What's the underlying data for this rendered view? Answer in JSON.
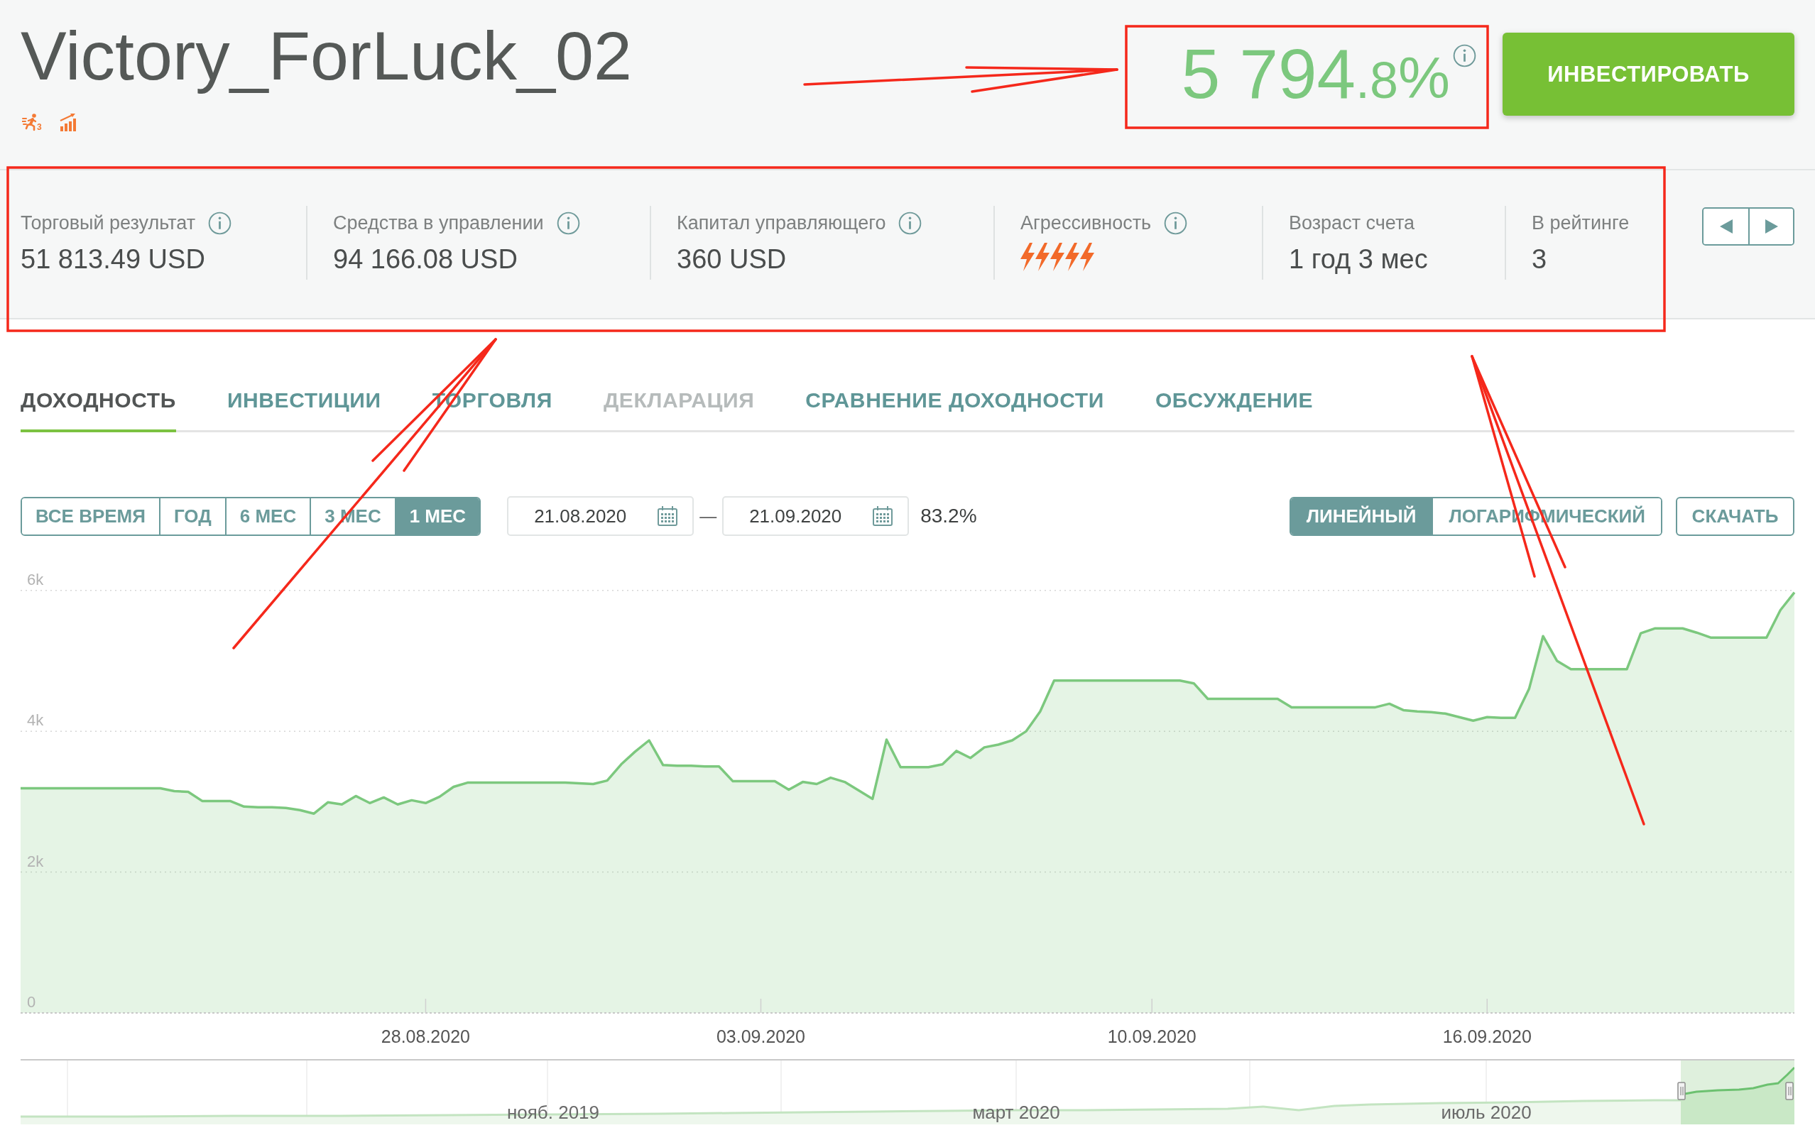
{
  "header": {
    "title": "Victory_ForLuck_02",
    "badges": [
      {
        "kind": "runner",
        "count": "3"
      },
      {
        "kind": "growth"
      }
    ],
    "return": {
      "integer": "5 794",
      "fraction": ".8",
      "unit": "%"
    },
    "invest_button": "ИНВЕСТИРОВАТЬ"
  },
  "stats": [
    {
      "kind": "value",
      "label": "Торговый результат",
      "info": true,
      "value": "51 813.49 USD"
    },
    {
      "kind": "value",
      "label": "Средства в управлении",
      "info": true,
      "value": "94 166.08 USD"
    },
    {
      "kind": "value",
      "label": "Капитал управляющего",
      "info": true,
      "value": "360 USD"
    },
    {
      "kind": "rating",
      "label": "Агрессивность",
      "info": true,
      "stars": 5
    },
    {
      "kind": "value",
      "label": "Возраст счета",
      "info": false,
      "value": "1 год 3 мес"
    },
    {
      "kind": "value",
      "label": "В рейтинге",
      "info": false,
      "value": "3"
    }
  ],
  "tabs": [
    {
      "label": "ДОХОДНОСТЬ",
      "selected": true,
      "disabled": false
    },
    {
      "label": "ИНВЕСТИЦИИ",
      "selected": false,
      "disabled": false
    },
    {
      "label": "ТОРГОВЛЯ",
      "selected": false,
      "disabled": false
    },
    {
      "label": "ДЕКЛАРАЦИЯ",
      "selected": false,
      "disabled": true
    },
    {
      "label": "СРАВНЕНИЕ ДОХОДНОСТИ",
      "selected": false,
      "disabled": false
    },
    {
      "label": "ОБСУЖДЕНИЕ",
      "selected": false,
      "disabled": false
    }
  ],
  "periods": [
    {
      "label": "ВСЕ ВРЕМЯ",
      "selected": false
    },
    {
      "label": "ГОД",
      "selected": false
    },
    {
      "label": "6 МЕС",
      "selected": false
    },
    {
      "label": "3 МЕС",
      "selected": false
    },
    {
      "label": "1 МЕС",
      "selected": true
    }
  ],
  "date_range": {
    "from": "21.08.2020",
    "separator": "—",
    "to": "21.09.2020",
    "change": "83.2%"
  },
  "scales": [
    {
      "label": "ЛИНЕЙНЫЙ",
      "selected": true
    },
    {
      "label": "ЛОГАРИФМИЧЕСКИЙ",
      "selected": false
    }
  ],
  "download_button": "СКАЧАТЬ",
  "chart": {
    "chart_data": {
      "type": "area",
      "grid": true,
      "categories": [
        null,
        null,
        null,
        null,
        null,
        null,
        null,
        null,
        null,
        null,
        null,
        null,
        null,
        null,
        null,
        null,
        null,
        null,
        null,
        null,
        null,
        null,
        null,
        null,
        null,
        null,
        null,
        null,
        null,
        "28.08.2020",
        null,
        null,
        null,
        null,
        null,
        null,
        null,
        null,
        null,
        null,
        null,
        null,
        null,
        null,
        null,
        null,
        null,
        null,
        null,
        null,
        null,
        null,
        null,
        "03.09.2020",
        null,
        null,
        null,
        null,
        null,
        null,
        null,
        null,
        null,
        null,
        null,
        null,
        null,
        null,
        null,
        null,
        null,
        null,
        null,
        null,
        null,
        null,
        null,
        null,
        null,
        null,
        null,
        "10.09.2020",
        null,
        null,
        null,
        null,
        null,
        null,
        null,
        null,
        null,
        null,
        null,
        null,
        null,
        null,
        null,
        null,
        null,
        null,
        null,
        null,
        null,
        null,
        null,
        "16.09.2020",
        null,
        null,
        null,
        null,
        null,
        null,
        null,
        null,
        null,
        null,
        null,
        null,
        null,
        null,
        null,
        null,
        null,
        null,
        null,
        null,
        null,
        null
      ],
      "series": [
        {
          "color": "#7cc87e",
          "values": [
            3190,
            3190,
            3190,
            3190,
            3190,
            3190,
            3190,
            3190,
            3190,
            3190,
            3190,
            3150,
            3140,
            3010,
            3010,
            3010,
            2930,
            2920,
            2920,
            2910,
            2880,
            2830,
            2990,
            2960,
            3080,
            2980,
            3060,
            2960,
            3020,
            2980,
            3070,
            3210,
            3270,
            3270,
            3270,
            3270,
            3270,
            3270,
            3270,
            3270,
            3260,
            3250,
            3300,
            3530,
            3710,
            3870,
            3520,
            3510,
            3510,
            3500,
            3500,
            3290,
            3290,
            3290,
            3290,
            3170,
            3280,
            3250,
            3340,
            3280,
            3160,
            3040,
            3880,
            3490,
            3490,
            3490,
            3530,
            3720,
            3620,
            3770,
            3810,
            3870,
            4000,
            4280,
            4720,
            4720,
            4720,
            4720,
            4720,
            4720,
            4720,
            4720,
            4720,
            4720,
            4680,
            4460,
            4460,
            4460,
            4460,
            4460,
            4460,
            4340,
            4340,
            4340,
            4340,
            4340,
            4340,
            4340,
            4390,
            4300,
            4280,
            4270,
            4250,
            4200,
            4150,
            4200,
            4190,
            4190,
            4600,
            5350,
            5000,
            4880,
            4880,
            4880,
            4880,
            4880,
            5390,
            5460,
            5460,
            5460,
            5400,
            5330,
            5330,
            5330,
            5330,
            5330,
            5720,
            5970
          ]
        }
      ],
      "ylim": [
        0,
        6400
      ],
      "yticks": [
        {
          "value": 0,
          "label": "0"
        },
        {
          "value": 2000,
          "label": "2k"
        },
        {
          "value": 4000,
          "label": "4k"
        },
        {
          "value": 6000,
          "label": "6k"
        }
      ]
    }
  },
  "navigator": {
    "labels": [
      "нояб. 2019",
      "март 2020",
      "июль 2020"
    ]
  },
  "annotations": [
    {
      "kind": "frame"
    },
    {
      "kind": "frame"
    },
    {
      "kind": "arrow"
    },
    {
      "kind": "arrow"
    },
    {
      "kind": "arrow"
    }
  ]
}
